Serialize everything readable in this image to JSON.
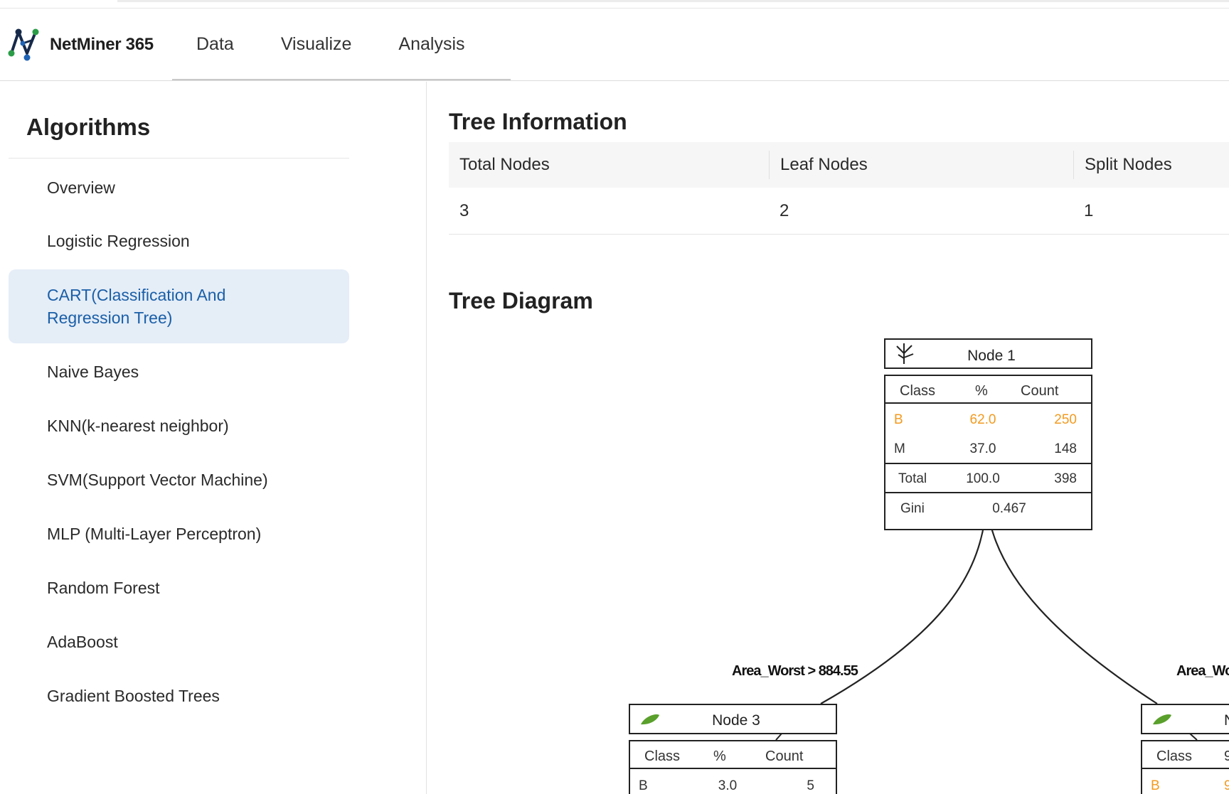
{
  "app": {
    "name": "NetMiner 365"
  },
  "nav": {
    "items": [
      "Data",
      "Visualize",
      "Analysis"
    ]
  },
  "sidebar": {
    "title": "Algorithms",
    "items": [
      "Overview",
      "Logistic Regression",
      "CART(Classification And Regression Tree)",
      "Naive Bayes",
      "KNN(k-nearest neighbor)",
      "SVM(Support Vector Machine)",
      "MLP (Multi-Layer Perceptron)",
      "Random Forest",
      "AdaBoost",
      "Gradient Boosted Trees"
    ],
    "active_index": 2
  },
  "tree_info": {
    "title": "Tree Information",
    "headers": [
      "Total Nodes",
      "Leaf Nodes",
      "Split Nodes"
    ],
    "values": [
      "3",
      "2",
      "1"
    ]
  },
  "tree_diagram": {
    "title": "Tree Diagram",
    "root": {
      "name": "Node 1",
      "headers": [
        "Class",
        "%",
        "Count"
      ],
      "rows": [
        {
          "class": "B",
          "pct": "62.0",
          "count": "250",
          "highlight": true
        },
        {
          "class": "M",
          "pct": "37.0",
          "count": "148",
          "highlight": false
        }
      ],
      "total": {
        "label": "Total",
        "pct": "100.0",
        "count": "398"
      },
      "gini": {
        "label": "Gini",
        "value": "0.467"
      }
    },
    "left_child": {
      "split_label": "Area_Worst > 884.55",
      "name": "Node 3",
      "headers": [
        "Class",
        "%",
        "Count"
      ],
      "first_row": {
        "class": "B",
        "pct": "3.0",
        "count": "5"
      }
    },
    "right_child": {
      "split_label": "Area_Wo",
      "name": "N",
      "headers": [
        "Class",
        "9"
      ],
      "first_row": {
        "class": "B",
        "pct": "9"
      }
    },
    "colors": {
      "highlight": "#f39a1e",
      "border": "#222222",
      "leaf": "#5aa02c"
    }
  }
}
